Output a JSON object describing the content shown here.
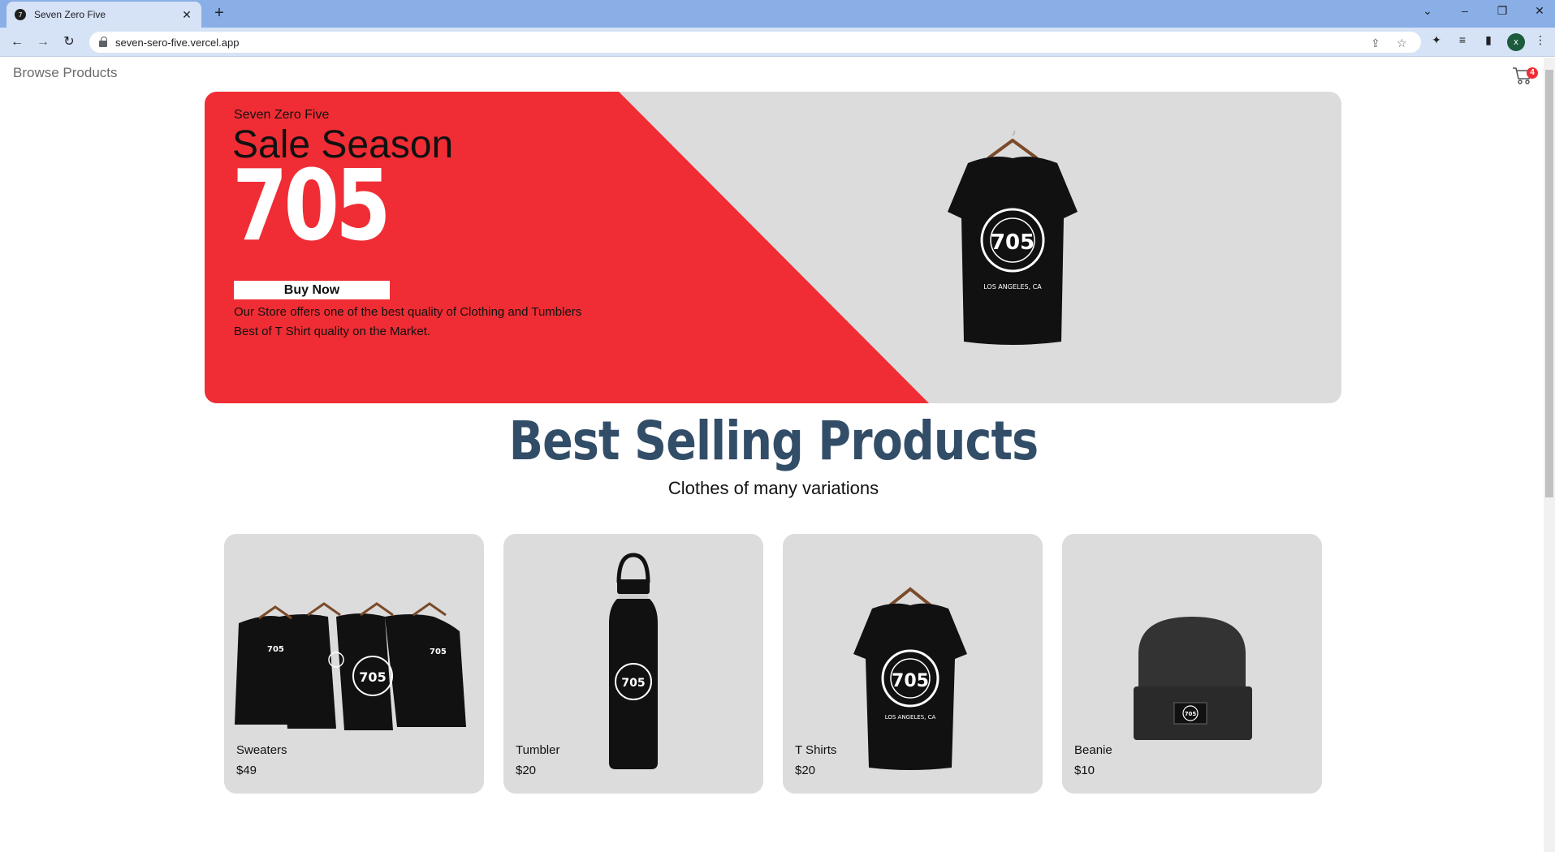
{
  "tab": {
    "title": "Seven Zero Five",
    "favicon": "7"
  },
  "toolbar": {
    "url": "seven-sero-five.vercel.app",
    "profile_initial": "x"
  },
  "nav": {
    "browse_label": "Browse Products",
    "cart_count": "4"
  },
  "hero": {
    "brand": "Seven Zero Five",
    "title": "Sale Season",
    "big_text": "705",
    "button_label": "Buy Now",
    "desc_line1": "Our Store offers one of the best quality of Clothing and Tumblers",
    "desc_line2": "Best of T Shirt quality on the Market."
  },
  "section": {
    "title": "Best Selling Products",
    "subtitle": "Clothes of many variations"
  },
  "products": [
    {
      "name": "Sweaters",
      "price": "$49"
    },
    {
      "name": "Tumbler",
      "price": "$20"
    },
    {
      "name": "T Shirts",
      "price": "$20"
    },
    {
      "name": "Beanie",
      "price": "$10"
    }
  ],
  "colors": {
    "accent_red": "#f02d34",
    "title_blue": "#324d67",
    "card_bg": "#dcdcdc"
  }
}
